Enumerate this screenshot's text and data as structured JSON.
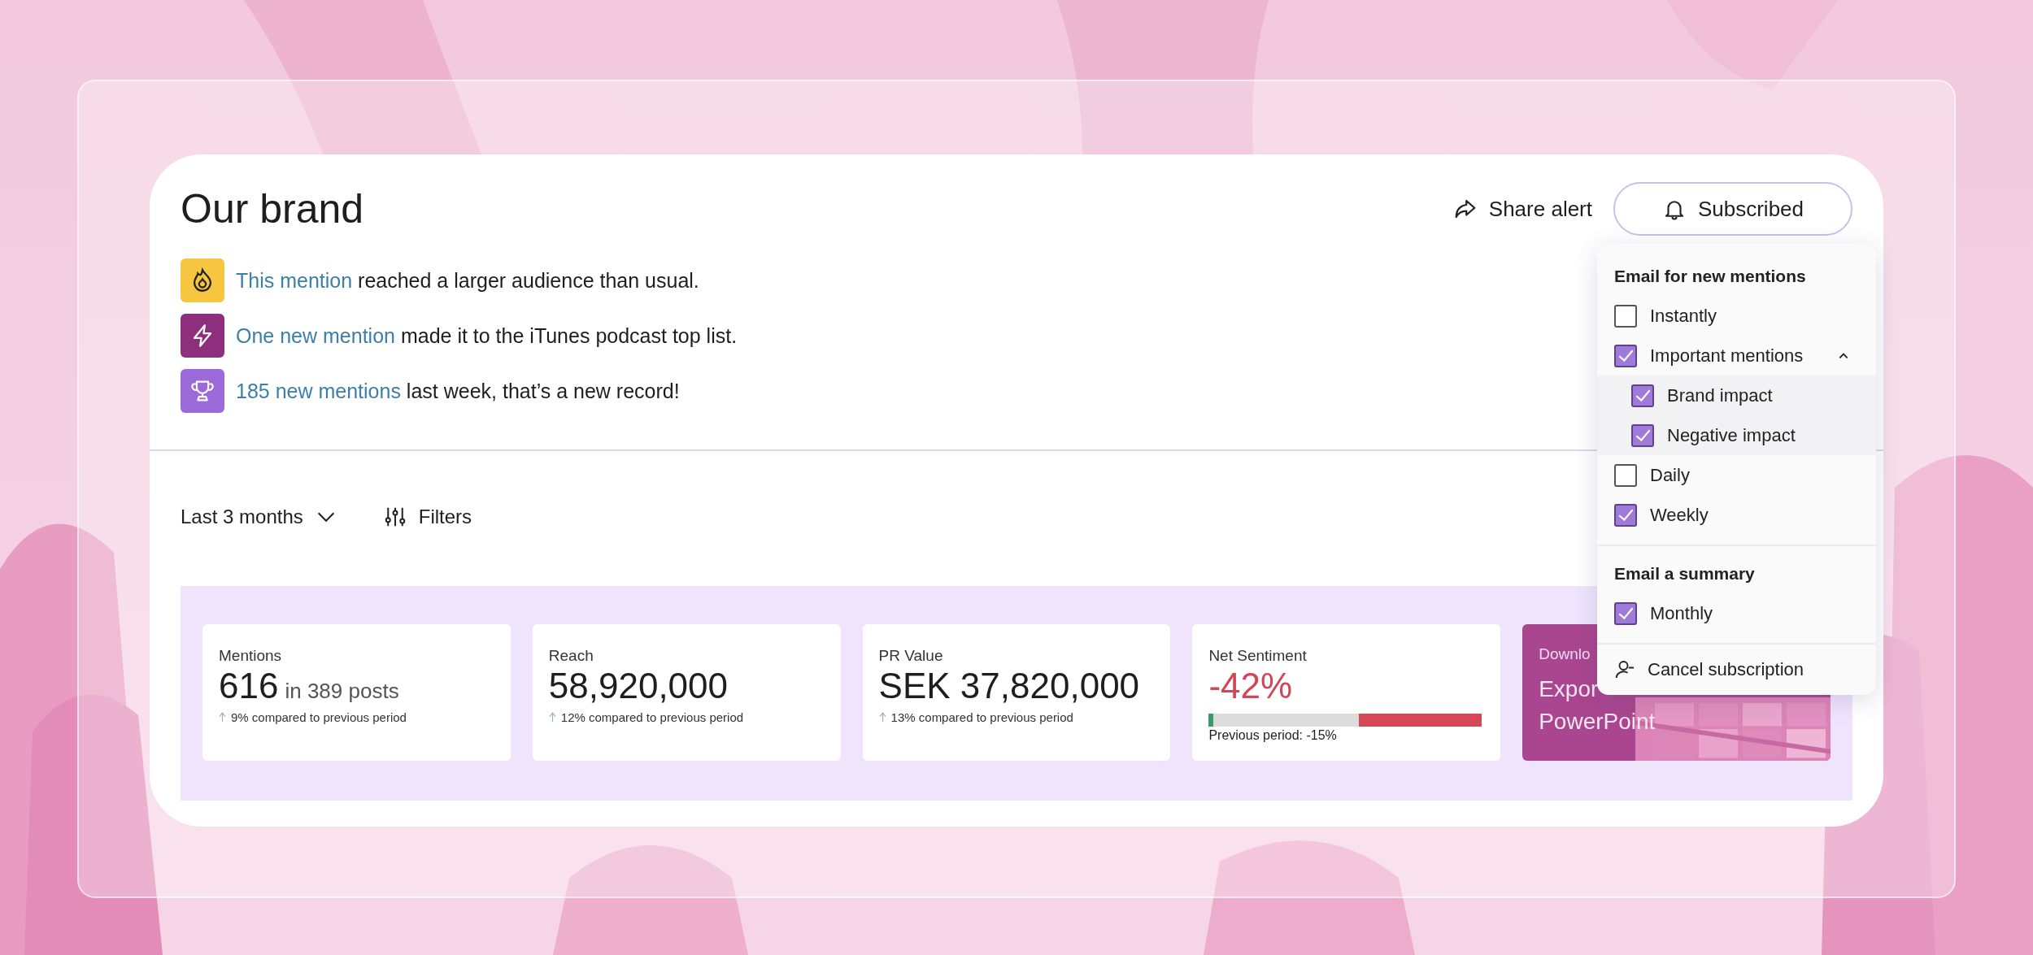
{
  "title": "Our brand",
  "actions": {
    "share": "Share alert",
    "subscribe": "Subscribed"
  },
  "alerts": [
    {
      "kind": "flame",
      "color": "#f7c640",
      "link": "This mention",
      "text": " reached a larger audience than usual."
    },
    {
      "kind": "bolt",
      "color": "#8e2f7e",
      "link": "One new mention",
      "text": " made it to the iTunes podcast top list."
    },
    {
      "kind": "trophy",
      "color": "#9b6ad8",
      "link": "185 new mentions",
      "text": " last week, that’s a new record!"
    }
  ],
  "filters": {
    "period": "Last 3 months",
    "filters": "Filters"
  },
  "stats": [
    {
      "kind": "metric",
      "label": "Mentions",
      "value": "616",
      "suffix": "in 389 posts",
      "change": "9% compared to previous period"
    },
    {
      "kind": "metric",
      "label": "Reach",
      "value": "58,920,000",
      "change": "12% compared to previous period"
    },
    {
      "kind": "metric",
      "label": "PR Value",
      "value": "SEK 37,820,000",
      "change": "13% compared to previous period"
    },
    {
      "kind": "sentiment",
      "label": "Net Sentiment",
      "value": "-42%",
      "level": 0.45,
      "note": "Previous period: -15%"
    },
    {
      "kind": "export",
      "label": "Downlo",
      "lines": [
        "Expor",
        "PowerPoint"
      ]
    }
  ],
  "subscription": {
    "sections": [
      {
        "heading": "Email for new mentions",
        "options": [
          {
            "label": "Instantly",
            "checked": false
          },
          {
            "label": "Important mentions",
            "checked": true,
            "expanded": true,
            "children": [
              {
                "label": "Brand impact",
                "checked": true
              },
              {
                "label": "Negative impact",
                "checked": true
              }
            ]
          },
          {
            "label": "Daily",
            "checked": false
          },
          {
            "label": "Weekly",
            "checked": true
          }
        ]
      },
      {
        "heading": "Email a summary",
        "options": [
          {
            "label": "Monthly",
            "checked": true
          }
        ]
      }
    ],
    "cancel": "Cancel subscription"
  }
}
